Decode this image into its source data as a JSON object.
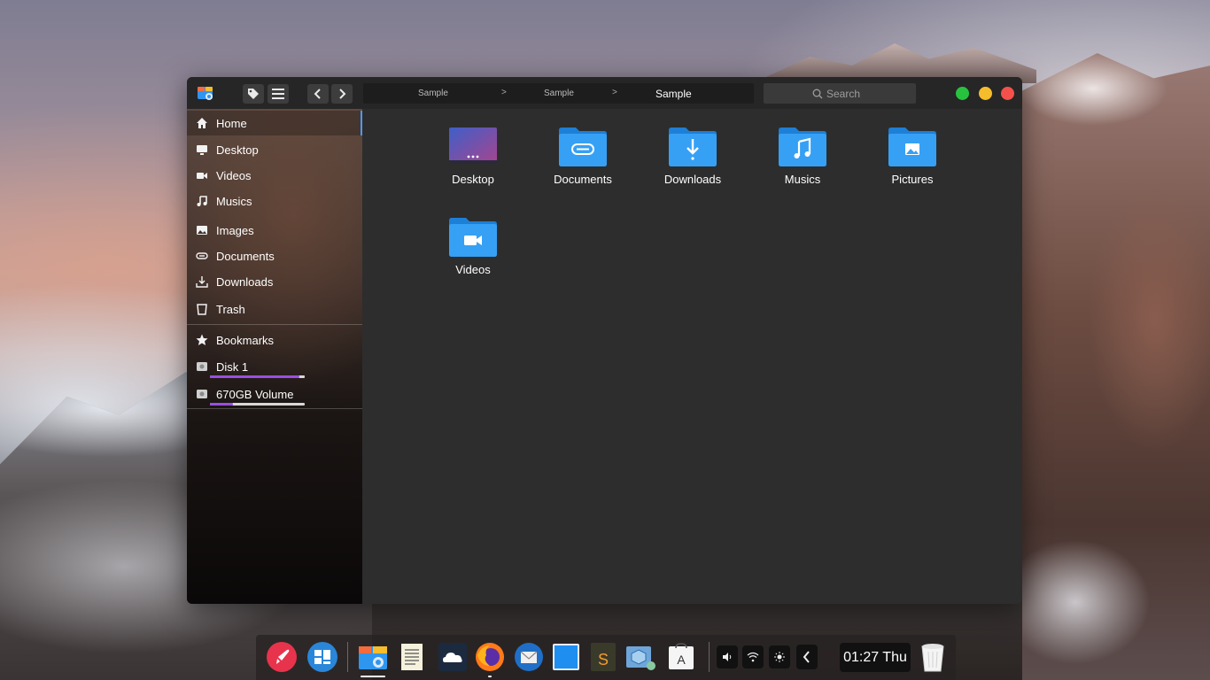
{
  "toolbar": {
    "breadcrumbs": [
      "Sample",
      "Sample",
      "Sample"
    ],
    "search_placeholder": "Search"
  },
  "sidebar": {
    "items": [
      {
        "label": "Home",
        "icon": "home-icon"
      },
      {
        "label": "Desktop",
        "icon": "monitor-icon"
      },
      {
        "label": "Videos",
        "icon": "video-camera-icon"
      },
      {
        "label": "Musics",
        "icon": "music-note-icon"
      },
      {
        "label": "Images",
        "icon": "image-icon"
      },
      {
        "label": "Documents",
        "icon": "paperclip-icon"
      },
      {
        "label": "Downloads",
        "icon": "download-icon"
      },
      {
        "label": "Trash",
        "icon": "trash-icon"
      }
    ],
    "bookmarks_label": "Bookmarks",
    "disks": [
      {
        "label": "Disk 1",
        "usage": 0.94
      },
      {
        "label": "670GB Volume",
        "usage": 0.24
      }
    ]
  },
  "content": {
    "folders": [
      {
        "label": "Desktop",
        "icon": "desktop-folder-icon"
      },
      {
        "label": "Documents",
        "icon": "documents-folder-icon"
      },
      {
        "label": "Downloads",
        "icon": "downloads-folder-icon"
      },
      {
        "label": "Musics",
        "icon": "music-folder-icon"
      },
      {
        "label": "Pictures",
        "icon": "pictures-folder-icon"
      },
      {
        "label": "Videos",
        "icon": "videos-folder-icon"
      }
    ]
  },
  "dock": {
    "clock": "01:27 Thu"
  },
  "colors": {
    "accent": "#4a9cf0",
    "folder_blue": "#2f96f0",
    "close": "#f4514c",
    "minimize": "#f5bd2c",
    "maximize": "#27c33e",
    "disk_fill": "#9b4fe0"
  }
}
